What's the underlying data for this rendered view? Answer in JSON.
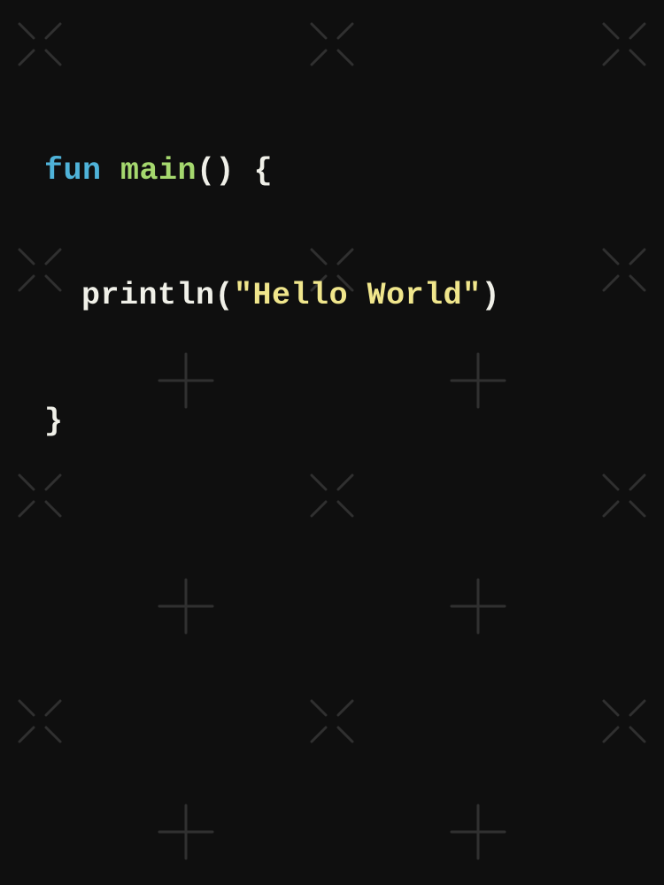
{
  "code": {
    "line1": {
      "keyword": "fun",
      "space1": " ",
      "funcname": "main",
      "parens": "()",
      "space2": " ",
      "brace_open": "{"
    },
    "line2": {
      "ident": "println",
      "paren_open": "(",
      "string": "\"Hello World\"",
      "paren_close": ")"
    },
    "line3": {
      "brace_close": "}"
    }
  },
  "colors": {
    "background": "#0f0f0f",
    "keyword": "#4fb3d9",
    "funcname": "#a5d86e",
    "default": "#f0f0e8",
    "string": "#f0e68c",
    "watermark": "#6d6d6d"
  }
}
